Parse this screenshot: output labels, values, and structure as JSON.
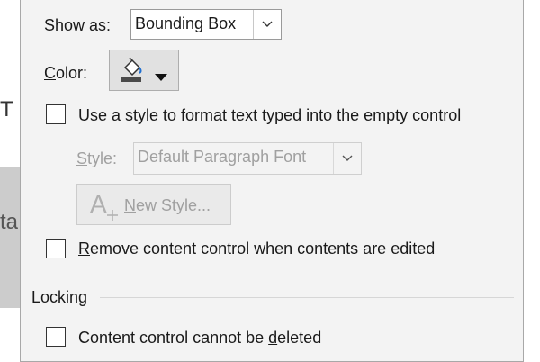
{
  "background": {
    "partial_text": "T",
    "partial_button_text": "ta"
  },
  "dialog": {
    "show_as": {
      "label_prefix": "S",
      "label_rest": "how as:",
      "value": "Bounding Box"
    },
    "color": {
      "label_prefix": "C",
      "label_rest": "olor:",
      "accent": "#4a4a4a"
    },
    "use_style": {
      "label_prefix": "U",
      "label_rest": "se a style to format text typed into the empty control",
      "checked": false
    },
    "style": {
      "label_prefix": "S",
      "label_rest": "tyle:",
      "value": "Default Paragraph Font"
    },
    "new_style": {
      "label_prefix": "N",
      "label_rest": "ew Style..."
    },
    "remove_content": {
      "label_prefix": "R",
      "label_rest": "emove content control when contents are edited",
      "checked": false
    },
    "locking": {
      "heading": "Locking"
    },
    "cannot_delete": {
      "label_before": "Content control cannot be ",
      "label_accel": "d",
      "label_after": "eleted",
      "checked": false
    }
  }
}
